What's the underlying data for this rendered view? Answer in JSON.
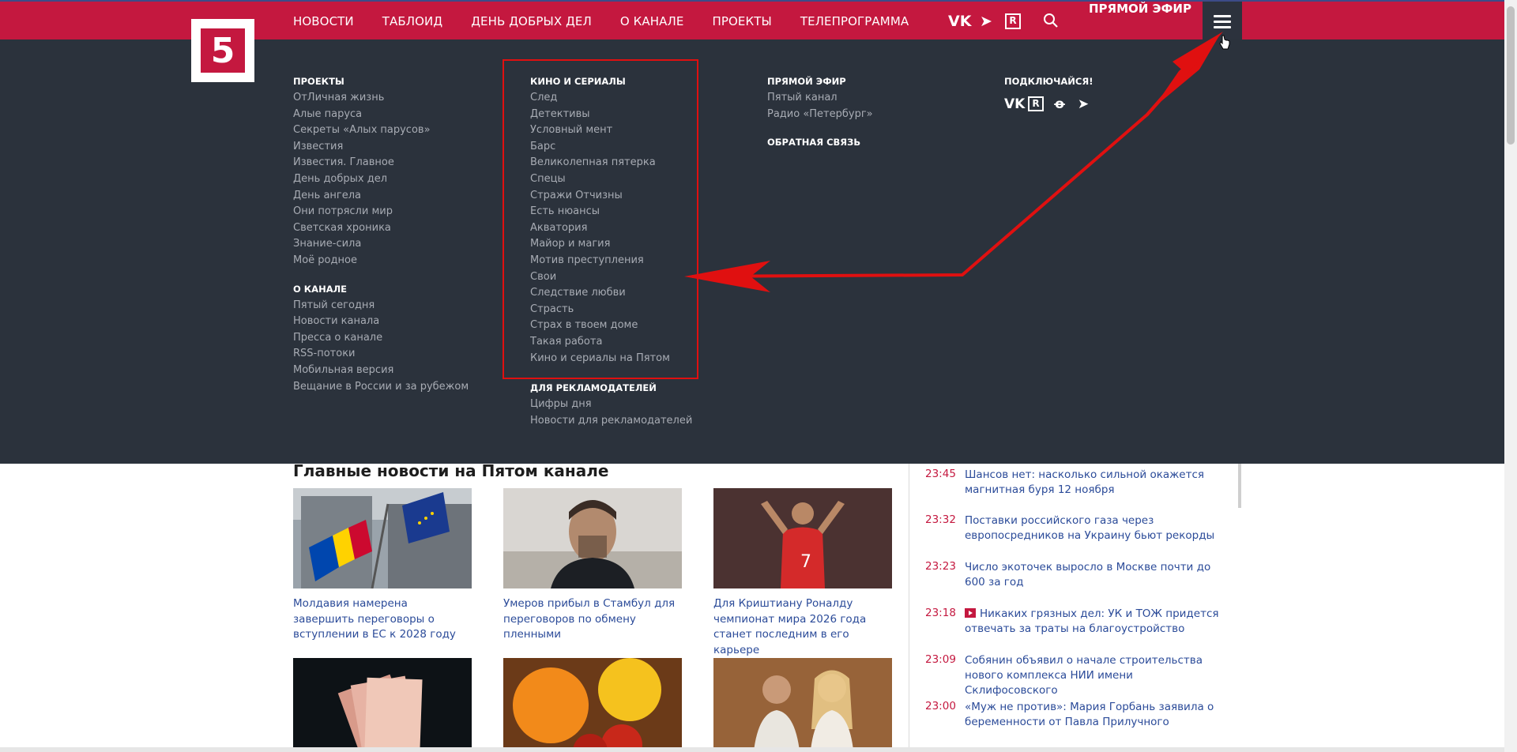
{
  "colors": {
    "brand_red": "#c4183f",
    "menu_bg": "#2b323c",
    "link_blue": "#2b4b99",
    "highlight": "#e01010"
  },
  "logo": {
    "text": "5"
  },
  "nav": {
    "items": [
      "НОВОСТИ",
      "ТАБЛОИД",
      "ДЕНЬ ДОБРЫХ ДЕЛ",
      "О КАНАЛЕ",
      "ПРОЕКТЫ",
      "ТЕЛЕПРОГРАММА"
    ],
    "icons": [
      "vk-icon",
      "telegram-icon",
      "rutube-icon",
      "search-icon"
    ],
    "vk": "VK",
    "tg": "➤",
    "rt": "R",
    "live": "ПРЯМОЙ ЭФИР",
    "menu_icon": "hamburger-menu-icon"
  },
  "menu": {
    "projects": {
      "heading": "ПРОЕКТЫ",
      "items": [
        "ОтЛичная жизнь",
        "Алые паруса",
        "Секреты «Алых парусов»",
        "Известия",
        "Известия. Главное",
        "День добрых дел",
        "День ангела",
        "Они потрясли мир",
        "Светская хроника",
        "Знание-сила",
        "Моё родное"
      ]
    },
    "channel": {
      "heading": "О КАНАЛЕ",
      "items": [
        "Пятый сегодня",
        "Новости канала",
        "Пресса о канале",
        "RSS-потоки",
        "Мобильная версия",
        "Вещание в России и за рубежом"
      ]
    },
    "series": {
      "heading": "КИНО И СЕРИАЛЫ",
      "items": [
        "След",
        "Детективы",
        "Условный мент",
        "Барс",
        "Великолепная пятерка",
        "Спецы",
        "Стражи Отчизны",
        "Есть нюансы",
        "Акватория",
        "Майор и магия",
        "Мотив преступления",
        "Свои",
        "Следствие любви",
        "Страсть",
        "Страх в твоем доме",
        "Такая работа",
        "Кино и сериалы на Пятом"
      ]
    },
    "advertisers": {
      "heading": "ДЛЯ РЕКЛАМОДАТЕЛЕЙ",
      "items": [
        "Цифры дня",
        "Новости для рекламодателей"
      ]
    },
    "live": {
      "heading": "ПРЯМОЙ ЭФИР",
      "items": [
        "Пятый канал",
        "Радио «Петербург»"
      ]
    },
    "feedback": {
      "heading": "ОБРАТНАЯ СВЯЗЬ"
    },
    "subscribe": {
      "heading": "ПОДКЛЮЧАЙСЯ!",
      "icons": [
        "vk-icon",
        "rutube-icon",
        "odnoklassniki-icon",
        "telegram-icon"
      ],
      "vk": "VK",
      "rt": "R",
      "ok": "ꝋ",
      "tg": "➤"
    }
  },
  "main": {
    "title": "Главные новости на Пятом канале",
    "cards": [
      {
        "caption": "Молдавия намерена завершить переговоры о вступлении в ЕС к 2028 году"
      },
      {
        "caption": "Умеров прибыл в Стамбул для переговоров по обмену пленными"
      },
      {
        "caption": "Для Криштиану Роналду чемпионат мира 2026 года станет последним в его карьере"
      }
    ]
  },
  "feed": [
    {
      "time": "23:45",
      "headline": "Шансов нет: насколько сильной окажется магнитная буря 12 ноября"
    },
    {
      "time": "23:32",
      "headline": "Поставки российского газа через европосредников на Украину бьют рекорды"
    },
    {
      "time": "23:23",
      "headline": "Число экоточек выросло в Москве почти до 600 за год"
    },
    {
      "time": "23:18",
      "headline": "Никаких грязных дел: УК и ТОЖ придется отвечать за траты на благоустройство",
      "video": true
    },
    {
      "time": "23:09",
      "headline": "Собянин объявил о начале строительства нового комплекса НИИ имени Склифосовского"
    },
    {
      "time": "23:00",
      "headline": "«Муж не против»: Мария Горбань заявила о беременности от Павла Прилучного"
    }
  ]
}
